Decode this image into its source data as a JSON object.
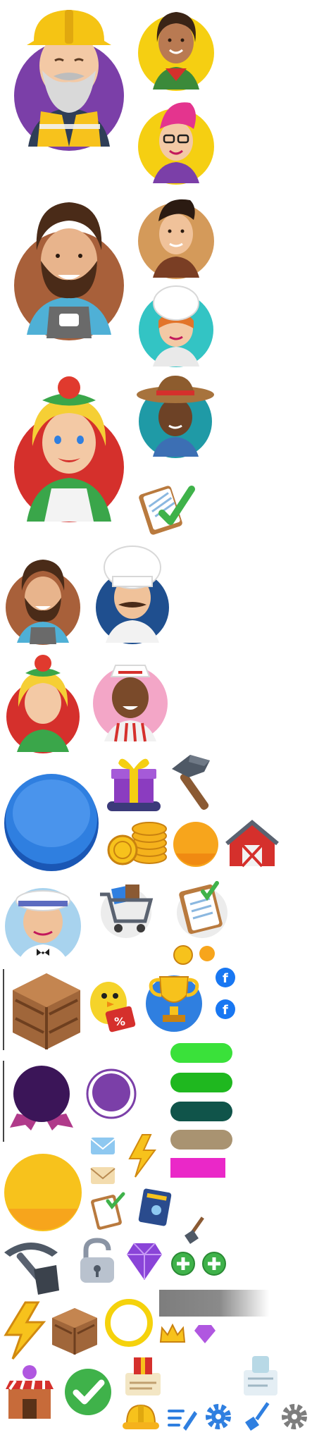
{
  "sheet": {
    "kind": "game-sprite-atlas",
    "background": "#ffffff"
  },
  "palette": {
    "yellow": "#f5cf12",
    "purple": "#7b3fa8",
    "dark_purple": "#3b1558",
    "blue": "#2f7fe0",
    "orange": "#f7a51c",
    "red": "#d5302c",
    "green": "#3fb24a",
    "bright_green": "#3ae13a",
    "teal_dark": "#10544a",
    "tan": "#a99371",
    "magenta": "#ea28c8",
    "gray": "#7d7d7d",
    "brown": "#8b5a33",
    "pink": "#f3a6c7",
    "light_blue": "#a8d3ee",
    "teal": "#33c4c4"
  },
  "sprites": [
    {
      "name": "avatar-construction-worker",
      "icon": "hard-hat-bearded-man-avatar"
    },
    {
      "name": "avatar-woman-red-scarf",
      "icon": "curly-hair-woman-avatar"
    },
    {
      "name": "avatar-pink-hair-glasses",
      "icon": "pink-hair-woman-avatar"
    },
    {
      "name": "avatar-barista-large",
      "icon": "bearded-barista-avatar"
    },
    {
      "name": "avatar-mechanic",
      "icon": "young-man-apron-avatar"
    },
    {
      "name": "avatar-female-chef",
      "icon": "chef-woman-avatar"
    },
    {
      "name": "avatar-farmer",
      "icon": "straw-hat-farmer-avatar"
    },
    {
      "name": "avatar-tomato-girl-large",
      "icon": "blonde-tomato-hat-avatar"
    },
    {
      "name": "clipboard-check-large",
      "icon": "clipboard-checkmark-icon"
    },
    {
      "name": "avatar-barista-small",
      "icon": "bearded-barista-avatar"
    },
    {
      "name": "avatar-male-chef",
      "icon": "mustache-chef-avatar"
    },
    {
      "name": "avatar-tomato-girl-small",
      "icon": "blonde-tomato-hat-avatar"
    },
    {
      "name": "avatar-soda-jerk",
      "icon": "paper-hat-man-avatar"
    },
    {
      "name": "blue-round-button",
      "icon": "blue-circle-button"
    },
    {
      "name": "gift-box",
      "icon": "purple-gift-icon"
    },
    {
      "name": "hammer",
      "icon": "hammer-icon"
    },
    {
      "name": "coin-stack",
      "icon": "gold-coins-icon"
    },
    {
      "name": "orange-circle",
      "icon": "orange-circle"
    },
    {
      "name": "barn",
      "icon": "red-barn-icon"
    },
    {
      "name": "avatar-cafe-man",
      "icon": "white-cap-man-avatar"
    },
    {
      "name": "shopping-cart",
      "icon": "cart-icon"
    },
    {
      "name": "clipboard-tasks",
      "icon": "clipboard-icon"
    },
    {
      "name": "small-coins",
      "icon": "coin-icon"
    },
    {
      "name": "wooden-crate-large",
      "icon": "crate-icon"
    },
    {
      "name": "chick-sale",
      "icon": "chick-discount-icon"
    },
    {
      "name": "trophy-badge",
      "icon": "trophy-icon"
    },
    {
      "name": "facebook-badges",
      "icon": "facebook-icon"
    },
    {
      "name": "purple-ribbon-badge",
      "icon": "ribbon-badge"
    },
    {
      "name": "purple-ring",
      "icon": "ring-frame"
    },
    {
      "name": "color-pill-buttons",
      "icon": "pill-button"
    },
    {
      "name": "envelopes",
      "icon": "mail-icon"
    },
    {
      "name": "lightning-small",
      "icon": "lightning-icon"
    },
    {
      "name": "big-orange-disc",
      "icon": "orange-circle"
    },
    {
      "name": "clipboard-small",
      "icon": "clipboard-icon"
    },
    {
      "name": "recipe-book",
      "icon": "book-icon"
    },
    {
      "name": "shovel-small",
      "icon": "shovel-icon"
    },
    {
      "name": "pickaxe",
      "icon": "pickaxe-icon"
    },
    {
      "name": "padlock",
      "icon": "lock-icon"
    },
    {
      "name": "purple-gem",
      "icon": "gem-icon"
    },
    {
      "name": "plus-buttons",
      "icon": "plus-icon"
    },
    {
      "name": "gray-gradient-bar",
      "icon": "fade-bar"
    },
    {
      "name": "lightning-large",
      "icon": "lightning-icon"
    },
    {
      "name": "wooden-crate-small",
      "icon": "crate-icon"
    },
    {
      "name": "yellow-ring",
      "icon": "ring-frame"
    },
    {
      "name": "small-crown",
      "icon": "crown-icon"
    },
    {
      "name": "small-gem",
      "icon": "gem-icon"
    },
    {
      "name": "shop-building",
      "icon": "store-icon"
    },
    {
      "name": "green-check-circle",
      "icon": "check-icon"
    },
    {
      "name": "gift-clipboard",
      "icon": "gift-clipboard-icon"
    },
    {
      "name": "frosted-clipboard",
      "icon": "clipboard-icon"
    },
    {
      "name": "hard-hat",
      "icon": "hard-hat-icon"
    },
    {
      "name": "edit-list",
      "icon": "edit-icon"
    },
    {
      "name": "gear-blue",
      "icon": "gear-icon"
    },
    {
      "name": "shovel-blue",
      "icon": "shovel-icon"
    },
    {
      "name": "gear-gray",
      "icon": "gear-icon"
    }
  ]
}
